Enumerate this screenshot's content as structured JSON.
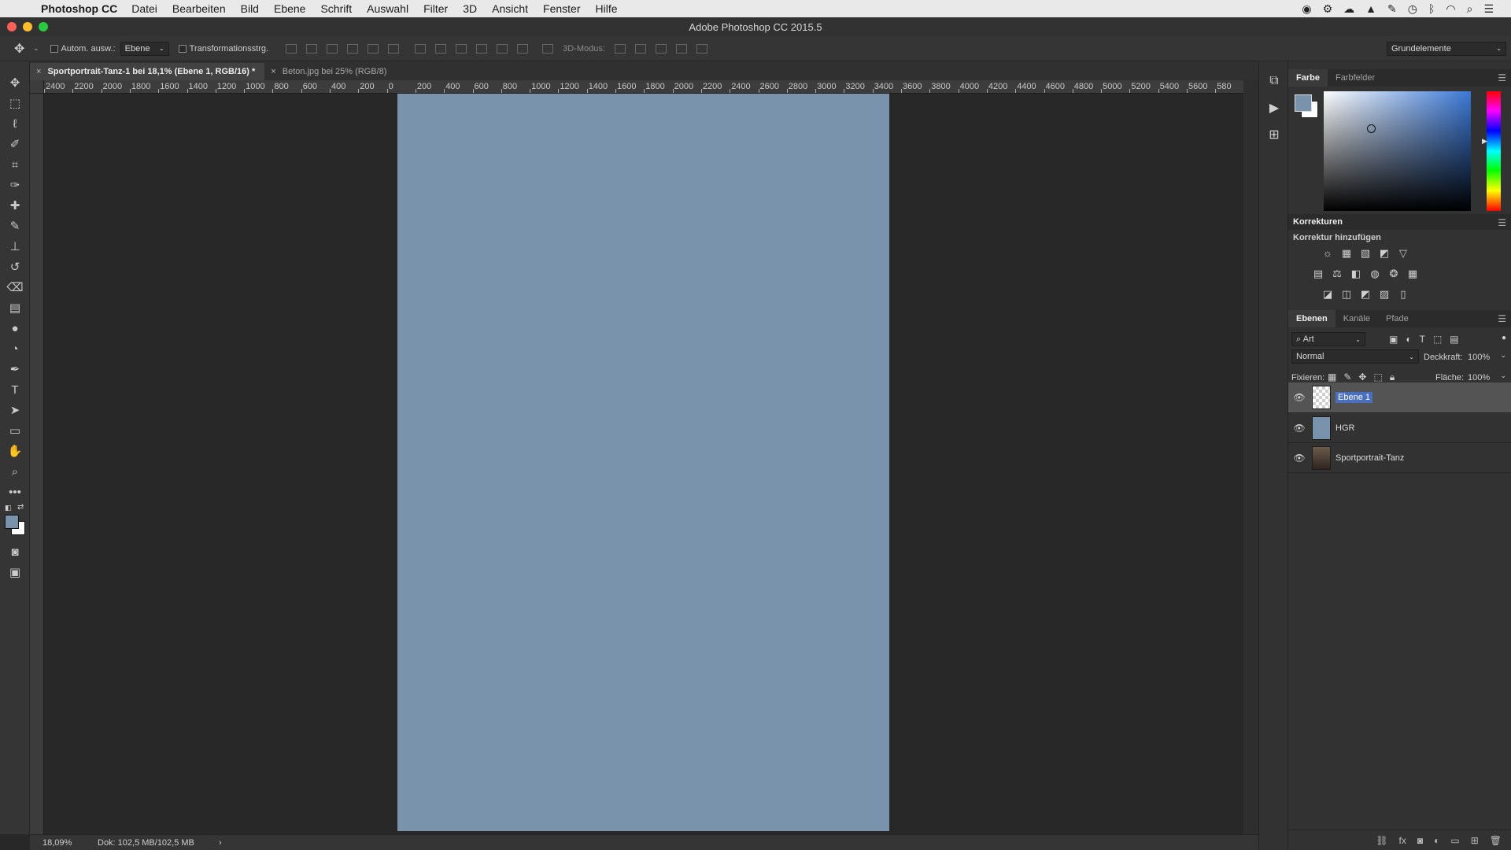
{
  "menubar": {
    "apple_icon": "apple-icon",
    "app_name": "Photoshop CC",
    "items": [
      "Datei",
      "Bearbeiten",
      "Bild",
      "Ebene",
      "Schrift",
      "Auswahl",
      "Filter",
      "3D",
      "Ansicht",
      "Fenster",
      "Hilfe"
    ],
    "status_icons": [
      "record-icon",
      "network-icon",
      "creative-cloud-icon",
      "adobe-icon",
      "script-icon",
      "timemachine-icon",
      "bluetooth-icon",
      "wifi-icon",
      "search-icon",
      "list-icon"
    ]
  },
  "window": {
    "title": "Adobe Photoshop CC 2015.5"
  },
  "options": {
    "auto_select_label": "Autom. ausw.:",
    "auto_select_value": "Ebene",
    "transform_label": "Transformationsstrg.",
    "mode_3d_label": "3D-Modus:",
    "workspace_value": "Grundelemente"
  },
  "tabs": [
    {
      "label": "Sportportrait-Tanz-1 bei 18,1% (Ebene 1, RGB/16) *",
      "active": true
    },
    {
      "label": "Beton.jpg bei 25% (RGB/8)",
      "active": false
    }
  ],
  "ruler": {
    "h_ticks": [
      "2400",
      "2200",
      "2000",
      "1800",
      "1600",
      "1400",
      "1200",
      "1000",
      "800",
      "600",
      "400",
      "200",
      "0",
      "200",
      "400",
      "600",
      "800",
      "1000",
      "1200",
      "1400",
      "1600",
      "1800",
      "2000",
      "2200",
      "2400",
      "2600",
      "2800",
      "3000",
      "3200",
      "3400",
      "3600",
      "3800",
      "4000",
      "4200",
      "4400",
      "4600",
      "4800",
      "5000",
      "5200",
      "5400",
      "5600",
      "580"
    ]
  },
  "status": {
    "zoom": "18,09%",
    "doc": "Dok: 102,5 MB/102,5 MB",
    "arrow": "›"
  },
  "color_panel": {
    "tab_color": "Farbe",
    "tab_swatches": "Farbfelder",
    "fg_color": "#7893ab",
    "bg_color": "#ffffff"
  },
  "adjustments": {
    "title": "Korrekturen",
    "subtitle": "Korrektur hinzufügen"
  },
  "layers_panel": {
    "tabs": [
      "Ebenen",
      "Kanäle",
      "Pfade"
    ],
    "filter_value": "Art",
    "blend_mode": "Normal",
    "opacity_label": "Deckkraft:",
    "opacity_value": "100%",
    "lock_label": "Fixieren:",
    "fill_label": "Fläche:",
    "fill_value": "100%",
    "layers": [
      {
        "name": "Ebene 1",
        "selected": true
      },
      {
        "name": "HGR",
        "selected": false
      },
      {
        "name": "Sportportrait-Tanz",
        "selected": false
      }
    ]
  }
}
